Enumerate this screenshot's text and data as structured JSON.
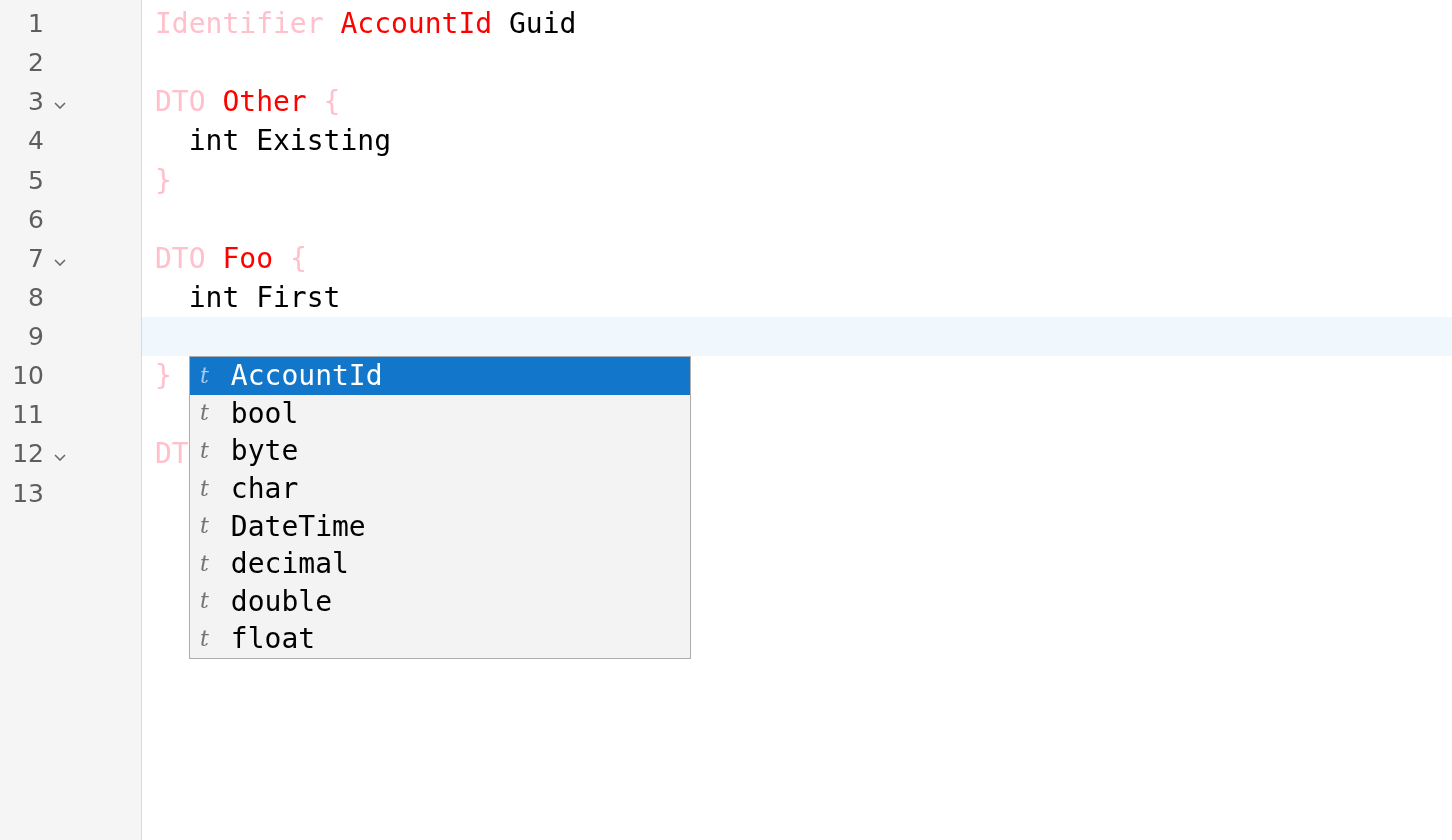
{
  "editor": {
    "lines": [
      {
        "number": "1",
        "foldable": false,
        "active": false,
        "indented": false,
        "tokens": [
          {
            "text": "Identifier",
            "kind": "keyword"
          },
          {
            "text": "AccountId",
            "kind": "name"
          },
          {
            "text": "Guid",
            "kind": "plain"
          }
        ]
      },
      {
        "number": "2",
        "foldable": false,
        "active": false
      },
      {
        "number": "3",
        "foldable": true,
        "active": false,
        "indented": false,
        "tokens": [
          {
            "text": "DTO",
            "kind": "keyword"
          },
          {
            "text": "Other",
            "kind": "name"
          },
          {
            "text": "{",
            "kind": "keyword"
          }
        ]
      },
      {
        "number": "4",
        "foldable": false,
        "active": false,
        "indented": true,
        "tokens": [
          {
            "text": "int",
            "kind": "plain"
          },
          {
            "text": "Existing",
            "kind": "plain"
          }
        ]
      },
      {
        "number": "5",
        "foldable": false,
        "active": false,
        "indented": false,
        "tokens": [
          {
            "text": "}",
            "kind": "keyword"
          }
        ]
      },
      {
        "number": "6",
        "foldable": false,
        "active": false
      },
      {
        "number": "7",
        "foldable": true,
        "active": false,
        "indented": false,
        "tokens": [
          {
            "text": "DTO",
            "kind": "keyword"
          },
          {
            "text": "Foo",
            "kind": "name"
          },
          {
            "text": "{",
            "kind": "keyword"
          }
        ]
      },
      {
        "number": "8",
        "foldable": false,
        "active": false,
        "indented": true,
        "tokens": [
          {
            "text": "int",
            "kind": "plain"
          },
          {
            "text": "First",
            "kind": "plain"
          }
        ]
      },
      {
        "number": "9",
        "foldable": false,
        "active": true
      },
      {
        "number": "10",
        "foldable": false,
        "active": false,
        "indented": false,
        "tokens": [
          {
            "text": "}",
            "kind": "keyword"
          }
        ]
      },
      {
        "number": "11",
        "foldable": false,
        "active": false
      },
      {
        "number": "12",
        "foldable": true,
        "active": false,
        "indented": false,
        "tokens": [
          {
            "text": "DT",
            "kind": "keyword"
          }
        ]
      },
      {
        "number": "13",
        "foldable": false,
        "active": false
      }
    ]
  },
  "completion": {
    "items": [
      {
        "icon": "t",
        "label": "AccountId",
        "selected": true
      },
      {
        "icon": "t",
        "label": "bool",
        "selected": false
      },
      {
        "icon": "t",
        "label": "byte",
        "selected": false
      },
      {
        "icon": "t",
        "label": "char",
        "selected": false
      },
      {
        "icon": "t",
        "label": "DateTime",
        "selected": false
      },
      {
        "icon": "t",
        "label": "decimal",
        "selected": false
      },
      {
        "icon": "t",
        "label": "double",
        "selected": false
      },
      {
        "icon": "t",
        "label": "float",
        "selected": false
      }
    ]
  }
}
